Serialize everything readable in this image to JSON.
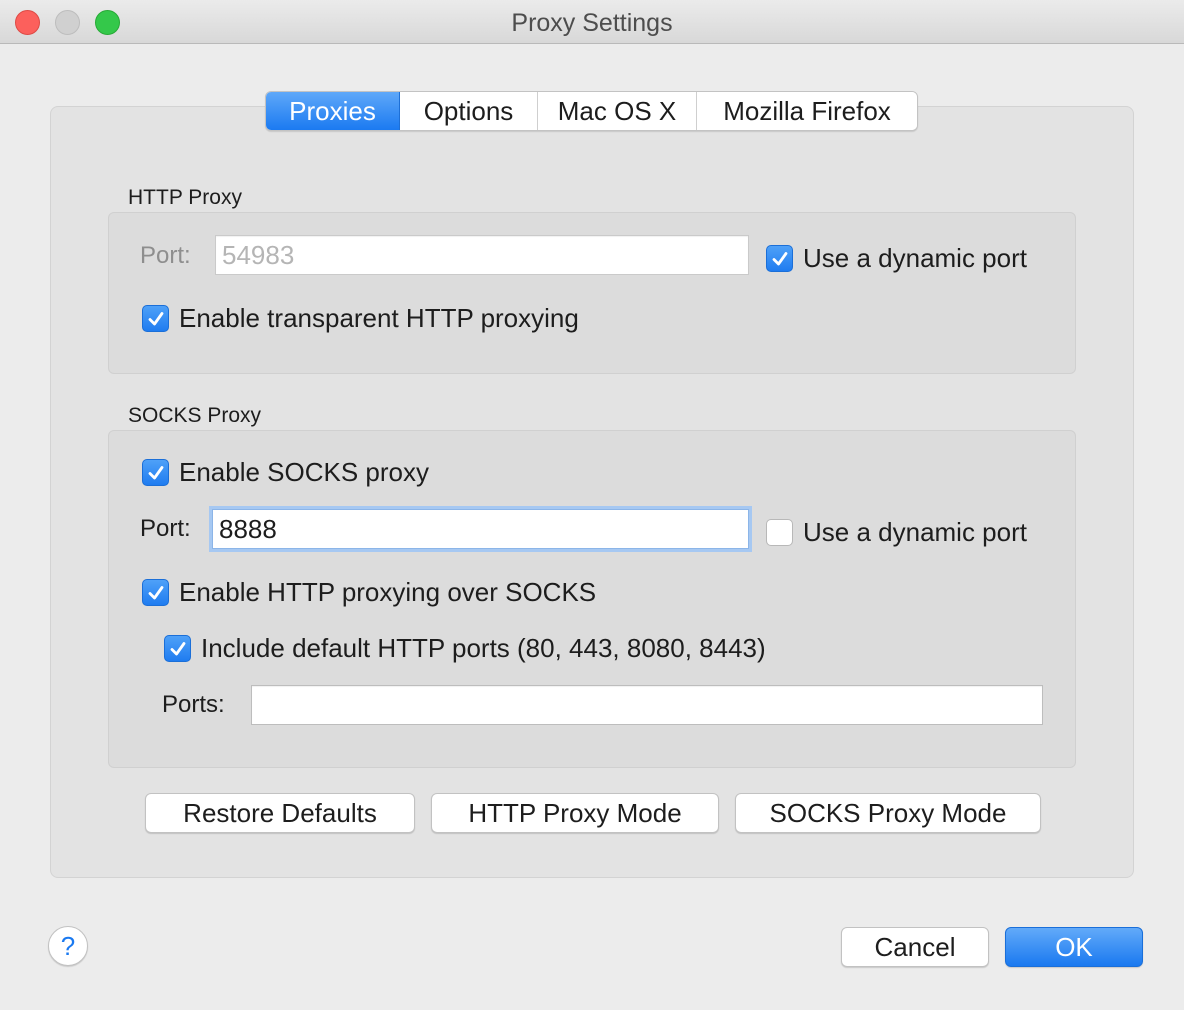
{
  "window": {
    "title": "Proxy Settings"
  },
  "tabs": [
    {
      "label": "Proxies",
      "active": true
    },
    {
      "label": "Options",
      "active": false
    },
    {
      "label": "Mac OS X",
      "active": false
    },
    {
      "label": "Mozilla Firefox",
      "active": false
    }
  ],
  "http_proxy": {
    "section_label": "HTTP Proxy",
    "port_label": "Port:",
    "port_value": "54983",
    "dynamic_port_label": "Use a dynamic port",
    "dynamic_port_checked": true,
    "transparent_label": "Enable transparent HTTP proxying",
    "transparent_checked": true
  },
  "socks_proxy": {
    "section_label": "SOCKS Proxy",
    "enable_label": "Enable SOCKS proxy",
    "enable_checked": true,
    "port_label": "Port:",
    "port_value": "8888",
    "dynamic_port_label": "Use a dynamic port",
    "dynamic_port_checked": false,
    "http_over_socks_label": "Enable HTTP proxying over SOCKS",
    "http_over_socks_checked": true,
    "include_default_ports_label": "Include default HTTP ports (80, 443, 8080, 8443)",
    "include_default_ports_checked": true,
    "ports_label": "Ports:",
    "ports_value": ""
  },
  "mode_buttons": {
    "restore_defaults": "Restore Defaults",
    "http_proxy_mode": "HTTP Proxy Mode",
    "socks_proxy_mode": "SOCKS Proxy Mode"
  },
  "footer": {
    "help": "?",
    "cancel": "Cancel",
    "ok": "OK"
  },
  "colors": {
    "accent": "#1a79f0",
    "close": "#fc605c",
    "maximize": "#34c84a"
  }
}
